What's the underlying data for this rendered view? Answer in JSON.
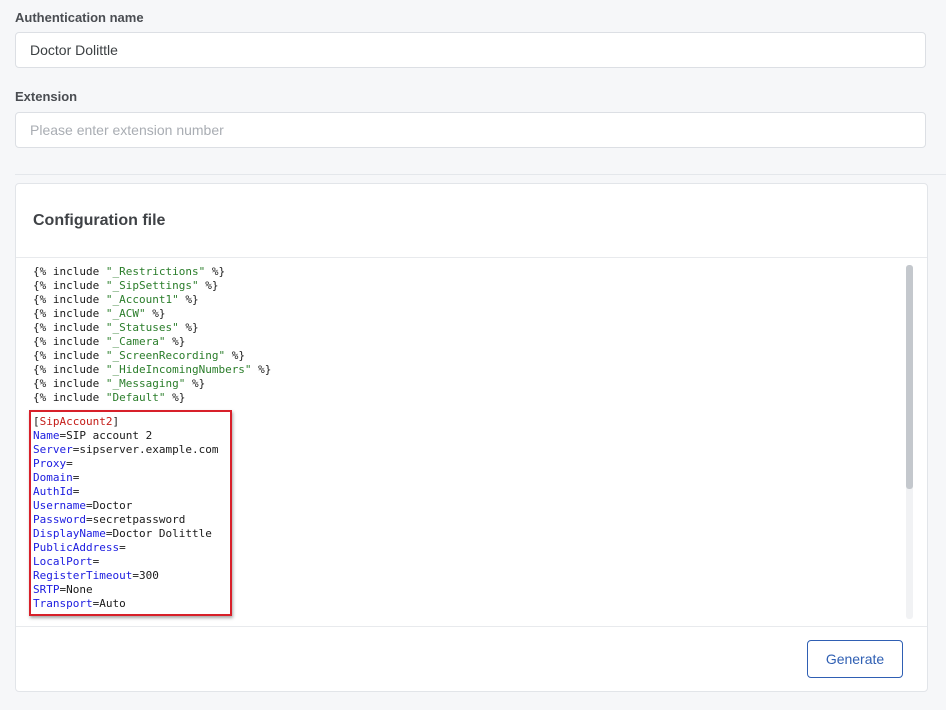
{
  "auth": {
    "label": "Authentication name",
    "value": "Doctor Dolittle"
  },
  "extension": {
    "label": "Extension",
    "value": "",
    "placeholder": "Please enter extension number"
  },
  "config": {
    "title": "Configuration file",
    "includes": [
      {
        "pre": "{% include ",
        "str": "\"_Restrictions\"",
        "post": " %}"
      },
      {
        "pre": "{% include ",
        "str": "\"_SipSettings\"",
        "post": " %}"
      },
      {
        "pre": "{% include ",
        "str": "\"_Account1\"",
        "post": " %}"
      },
      {
        "pre": "{% include ",
        "str": "\"_ACW\"",
        "post": " %}"
      },
      {
        "pre": "{% include ",
        "str": "\"_Statuses\"",
        "post": " %}"
      },
      {
        "pre": "{% include ",
        "str": "\"_Camera\"",
        "post": " %}"
      },
      {
        "pre": "{% include ",
        "str": "\"_ScreenRecording\"",
        "post": " %}"
      },
      {
        "pre": "{% include ",
        "str": "\"_HideIncomingNumbers\"",
        "post": " %}"
      },
      {
        "pre": "{% include ",
        "str": "\"_Messaging\"",
        "post": " %}"
      },
      {
        "pre": "{% include ",
        "str": "\"Default\"",
        "post": " %}"
      }
    ],
    "section": {
      "open": "[",
      "name": "SipAccount2",
      "close": "]"
    },
    "settings": [
      {
        "key": "Name",
        "value": "SIP account 2"
      },
      {
        "key": "Server",
        "value": "sipserver.example.com"
      },
      {
        "key": "Proxy",
        "value": ""
      },
      {
        "key": "Domain",
        "value": ""
      },
      {
        "key": "AuthId",
        "value": ""
      },
      {
        "key": "Username",
        "value": "Doctor"
      },
      {
        "key": "Password",
        "value": "secretpassword"
      },
      {
        "key": "DisplayName",
        "value": "Doctor Dolittle"
      },
      {
        "key": "PublicAddress",
        "value": ""
      },
      {
        "key": "LocalPort",
        "value": ""
      },
      {
        "key": "RegisterTimeout",
        "value": "300"
      },
      {
        "key": "SRTP",
        "value": "None"
      },
      {
        "key": "Transport",
        "value": "Auto"
      }
    ]
  },
  "generate_button": {
    "label": "Generate"
  },
  "colors": {
    "accent": "#2f5fb3",
    "highlight": "#d8202a",
    "string": "#2a7d2a",
    "key": "#1b1be0",
    "section": "#c41a16"
  }
}
